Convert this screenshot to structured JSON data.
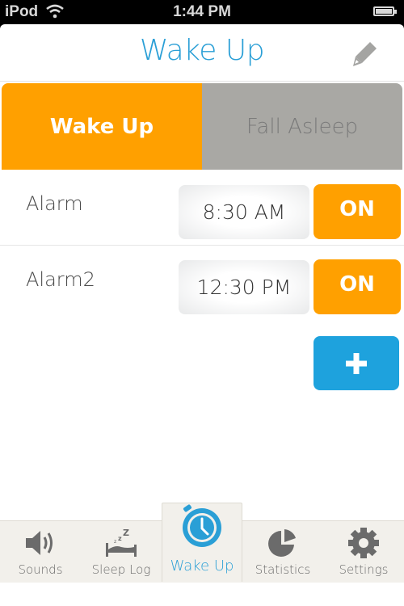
{
  "status_bar": {
    "carrier": "iPod",
    "time": "1:44 PM"
  },
  "nav": {
    "title": "Wake Up",
    "edit_icon": "pencil-icon"
  },
  "segments": [
    {
      "label": "Wake Up",
      "active": true
    },
    {
      "label": "Fall Asleep",
      "active": false
    }
  ],
  "alarms": [
    {
      "name": "Alarm",
      "time": "8:30 AM",
      "toggle": "ON"
    },
    {
      "name": "Alarm2",
      "time": "12:30 PM",
      "toggle": "ON"
    }
  ],
  "add_button": {
    "icon": "plus-icon"
  },
  "tabs": [
    {
      "label": "Sounds",
      "icon": "speaker-icon"
    },
    {
      "label": "Sleep Log",
      "icon": "bed-icon"
    },
    {
      "label": "Wake Up",
      "icon": "alarm-clock-icon",
      "active": true
    },
    {
      "label": "Statistics",
      "icon": "pie-chart-icon"
    },
    {
      "label": "Settings",
      "icon": "gear-icon"
    }
  ],
  "colors": {
    "accent_blue": "#2a9fd6",
    "orange": "#ffa000",
    "gray_segment": "#a9a8a4",
    "add_blue": "#1ea2dd",
    "tabbar_bg": "#f2f0eb"
  }
}
